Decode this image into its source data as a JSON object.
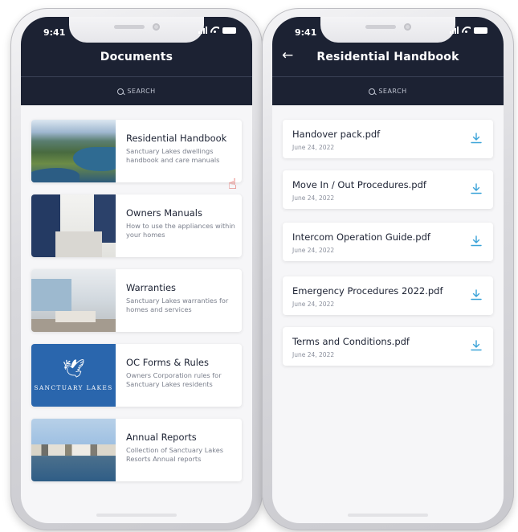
{
  "left_screen": {
    "status": {
      "time": "9:41"
    },
    "title": "Documents",
    "search_label": "SEARCH",
    "items": [
      {
        "title": "Residential Handbook",
        "description": "Sanctuary Lakes dwellings handbook and care manuals"
      },
      {
        "title": "Owners Manuals",
        "description": "How to use the appliances within your homes"
      },
      {
        "title": "Warranties",
        "description": "Sanctuary Lakes warranties for homes and services"
      },
      {
        "title": "OC Forms & Rules",
        "description": "Owners Corporation rules for Sanctuary Lakes residents",
        "logo_text": "SANCTUARY LAKES"
      },
      {
        "title": "Annual Reports",
        "description": "Collection of Sanctuary Lakes Resorts Annual reports"
      }
    ]
  },
  "right_screen": {
    "status": {
      "time": "9:41"
    },
    "title": "Residential Handbook",
    "search_label": "SEARCH",
    "files": [
      {
        "name": "Handover pack.pdf",
        "date": "June 24, 2022"
      },
      {
        "name": "Move In / Out Procedures.pdf",
        "date": "June 24, 2022"
      },
      {
        "name": "Intercom Operation Guide.pdf",
        "date": "June 24, 2022"
      },
      {
        "name": "Emergency Procedures 2022.pdf",
        "date": "June 24, 2022"
      },
      {
        "name": "Terms and Conditions.pdf",
        "date": "June 24, 2022"
      }
    ]
  },
  "colors": {
    "header": "#1c2233",
    "accent": "#3aa3d8",
    "pointer": "#d8342c",
    "logo_bg": "#2a66ad"
  },
  "icons": [
    "back-arrow-icon",
    "search-icon",
    "download-icon",
    "hand-pointer-icon",
    "bird-logo-icon",
    "signal-icon",
    "wifi-icon",
    "battery-icon"
  ]
}
